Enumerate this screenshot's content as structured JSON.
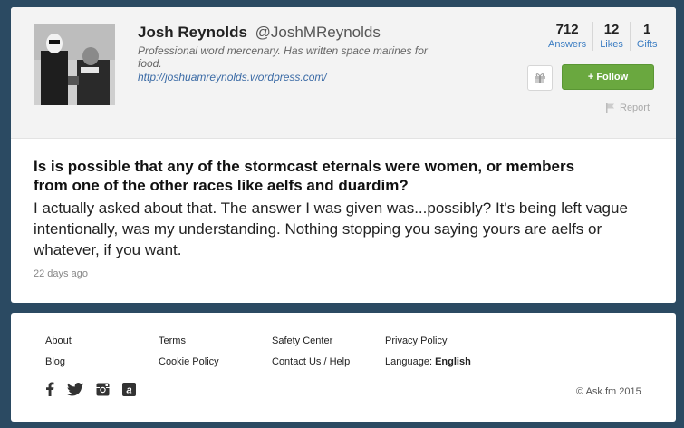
{
  "profile": {
    "name": "Josh Reynolds",
    "handle": "@JoshMReynolds",
    "bio": "Professional word mercenary. Has written space marines for food.",
    "website": "http://joshuamreynolds.wordpress.com/",
    "stats": [
      {
        "value": "712",
        "label": "Answers"
      },
      {
        "value": "12",
        "label": "Likes"
      },
      {
        "value": "1",
        "label": "Gifts"
      }
    ],
    "follow_label": "+ Follow",
    "report_label": "Report"
  },
  "post": {
    "question": "Is is possible that any of the stormcast eternals were women, or members from one of the other races like aelfs and duardim?",
    "answer": "I actually asked about that. The answer I was given was...possibly? It's being left vague intentionally, was my understanding. Nothing stopping you saying yours are aelfs or whatever, if you want.",
    "time": "22 days ago"
  },
  "footer": {
    "links": {
      "about": "About",
      "blog": "Blog",
      "terms": "Terms",
      "cookie_policy": "Cookie Policy",
      "safety_center": "Safety Center",
      "contact": "Contact Us / Help",
      "privacy": "Privacy Policy",
      "language_label": "Language:",
      "language_value": "English"
    },
    "social_icons": [
      "facebook-icon",
      "twitter-icon",
      "instagram-icon",
      "askfm-icon"
    ],
    "copyright": "© Ask.fm 2015"
  },
  "colors": {
    "background": "#2b4a62",
    "follow": "#6aa83f",
    "link": "#3a7cc2"
  }
}
